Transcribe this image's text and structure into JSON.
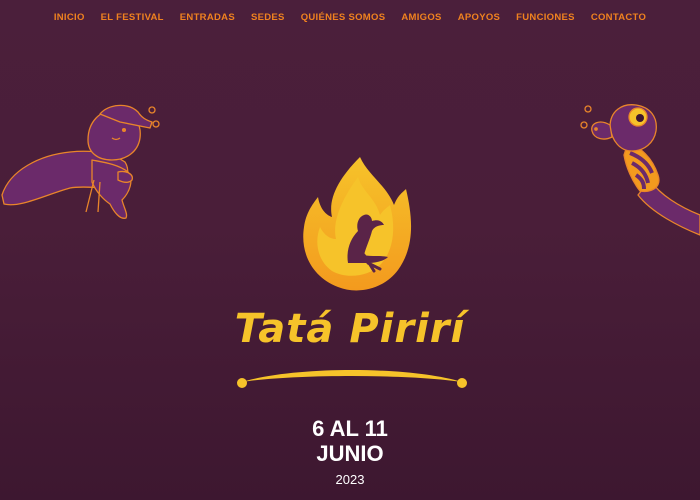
{
  "nav": {
    "items": [
      {
        "label": "INICIO"
      },
      {
        "label": "EL FESTIVAL"
      },
      {
        "label": "ENTRADAS"
      },
      {
        "label": "SEDES"
      },
      {
        "label": "QUIÉNES SOMOS"
      },
      {
        "label": "AMIGOS"
      },
      {
        "label": "APOYOS"
      },
      {
        "label": "FUNCIONES"
      },
      {
        "label": "CONTACTO"
      }
    ]
  },
  "hero": {
    "logo_text": "Tatá Pirirí",
    "date_line1": "6 AL 11",
    "date_line2": "JUNIO",
    "year": "2023"
  },
  "colors": {
    "background": "#4a1e39",
    "nav_text": "#f0821f",
    "logo_yellow": "#f6c32a",
    "flame_orange": "#f39a1e",
    "character_purple": "#6b2a6a",
    "character_outline": "#e9852a"
  }
}
